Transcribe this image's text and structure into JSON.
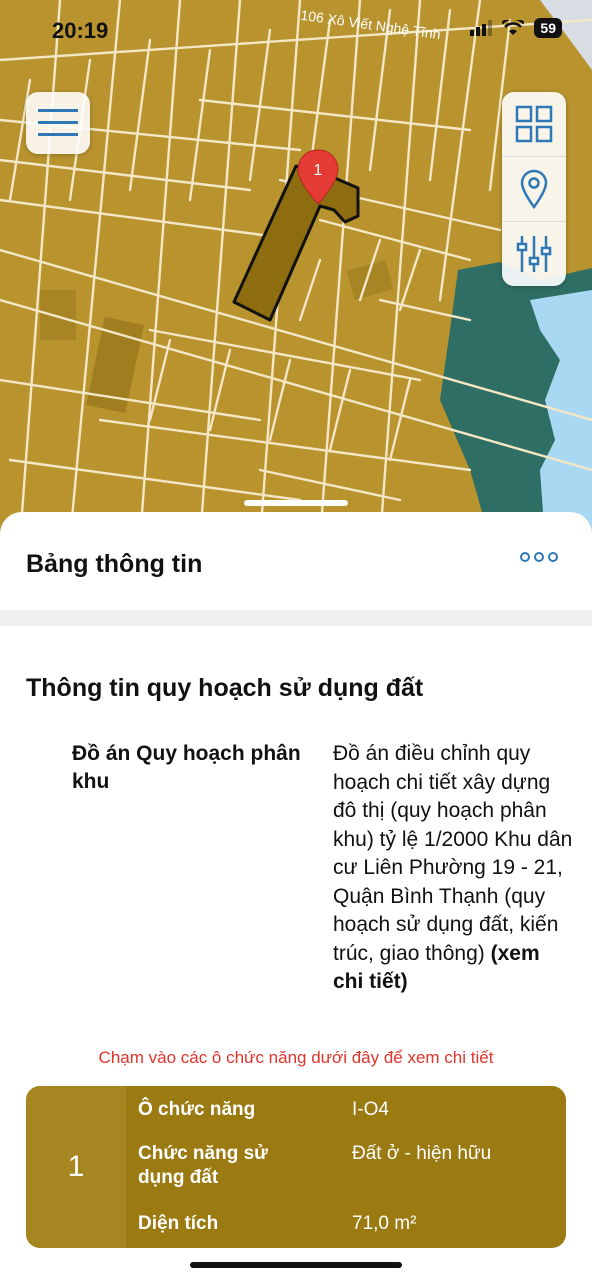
{
  "status_bar": {
    "time": "20:19",
    "battery": "59"
  },
  "map": {
    "street_label": "106 Xô Viết Nghệ Tĩnh",
    "pin_number": "1"
  },
  "map_controls": {
    "menu_icon": "hamburger-icon",
    "layers_icon": "grid-icon",
    "location_icon": "location-pin-icon",
    "filter_icon": "sliders-icon"
  },
  "panel": {
    "title": "Bảng thông tin",
    "more_icon": "more-dots-icon",
    "section_title": "Thông tin quy hoạch sử dụng đất",
    "plan_label": "Đồ án Quy hoạch phân khu",
    "plan_value": "Đồ án điều chỉnh quy hoạch chi tiết xây dựng đô thị (quy hoạch phân khu) tỷ lệ 1/2000  Khu dân cư Liên Phường 19 - 21, Quận Bình Thạnh (quy hoạch sử dụng đất, kiến trúc, giao thông)",
    "plan_link": "(xem chi tiết)",
    "hint": "Chạm vào các ô chức năng dưới đây để xem chi tiết"
  },
  "function_card": {
    "index": "1",
    "rows": [
      {
        "label": "Ô chức năng",
        "value": "I-O4"
      },
      {
        "label": "Chức năng sử dụng đất",
        "value": "Đất ở - hiện hữu"
      },
      {
        "label": "Diện tích",
        "value": "71,0 m²"
      }
    ]
  },
  "colors": {
    "map_land": "#b8932e",
    "map_parcel_dark": "#8e6c10",
    "map_water": "#a9d8f2",
    "map_green": "#2f6e64",
    "card_bg": "#9b7a12",
    "hint_red": "#e0342b",
    "accent_blue": "#2e78b5"
  }
}
